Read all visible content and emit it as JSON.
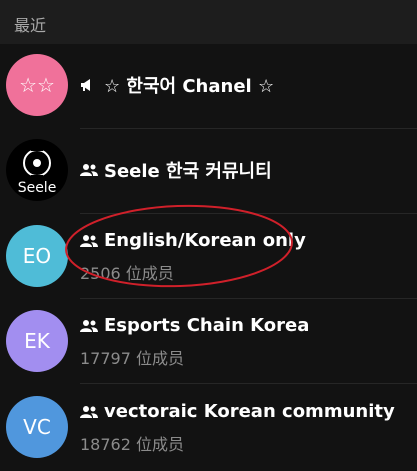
{
  "section": {
    "title": "最近"
  },
  "chats": [
    {
      "avatar_text": "☆☆",
      "avatar_color": "#f0719a",
      "icon": "megaphone-icon",
      "title": "☆ 한국어 Chanel ☆",
      "subtitle": ""
    },
    {
      "avatar_text": "Seele",
      "avatar_color": "#000000",
      "icon": "group-icon",
      "title": "Seele 한국 커뮤니티",
      "subtitle": ""
    },
    {
      "avatar_text": "EO",
      "avatar_color": "#4fbcd7",
      "icon": "group-icon",
      "title": "English/Korean only",
      "subtitle": "2506 位成员"
    },
    {
      "avatar_text": "EK",
      "avatar_color": "#a28ef0",
      "icon": "group-icon",
      "title": "Esports Chain Korea",
      "subtitle": "17797 位成员"
    },
    {
      "avatar_text": "VC",
      "avatar_color": "#5097dd",
      "icon": "group-icon",
      "title": "vectoraic Korean community",
      "subtitle": "18762 位成员"
    }
  ],
  "annotation": {
    "color": "#d0202a"
  }
}
